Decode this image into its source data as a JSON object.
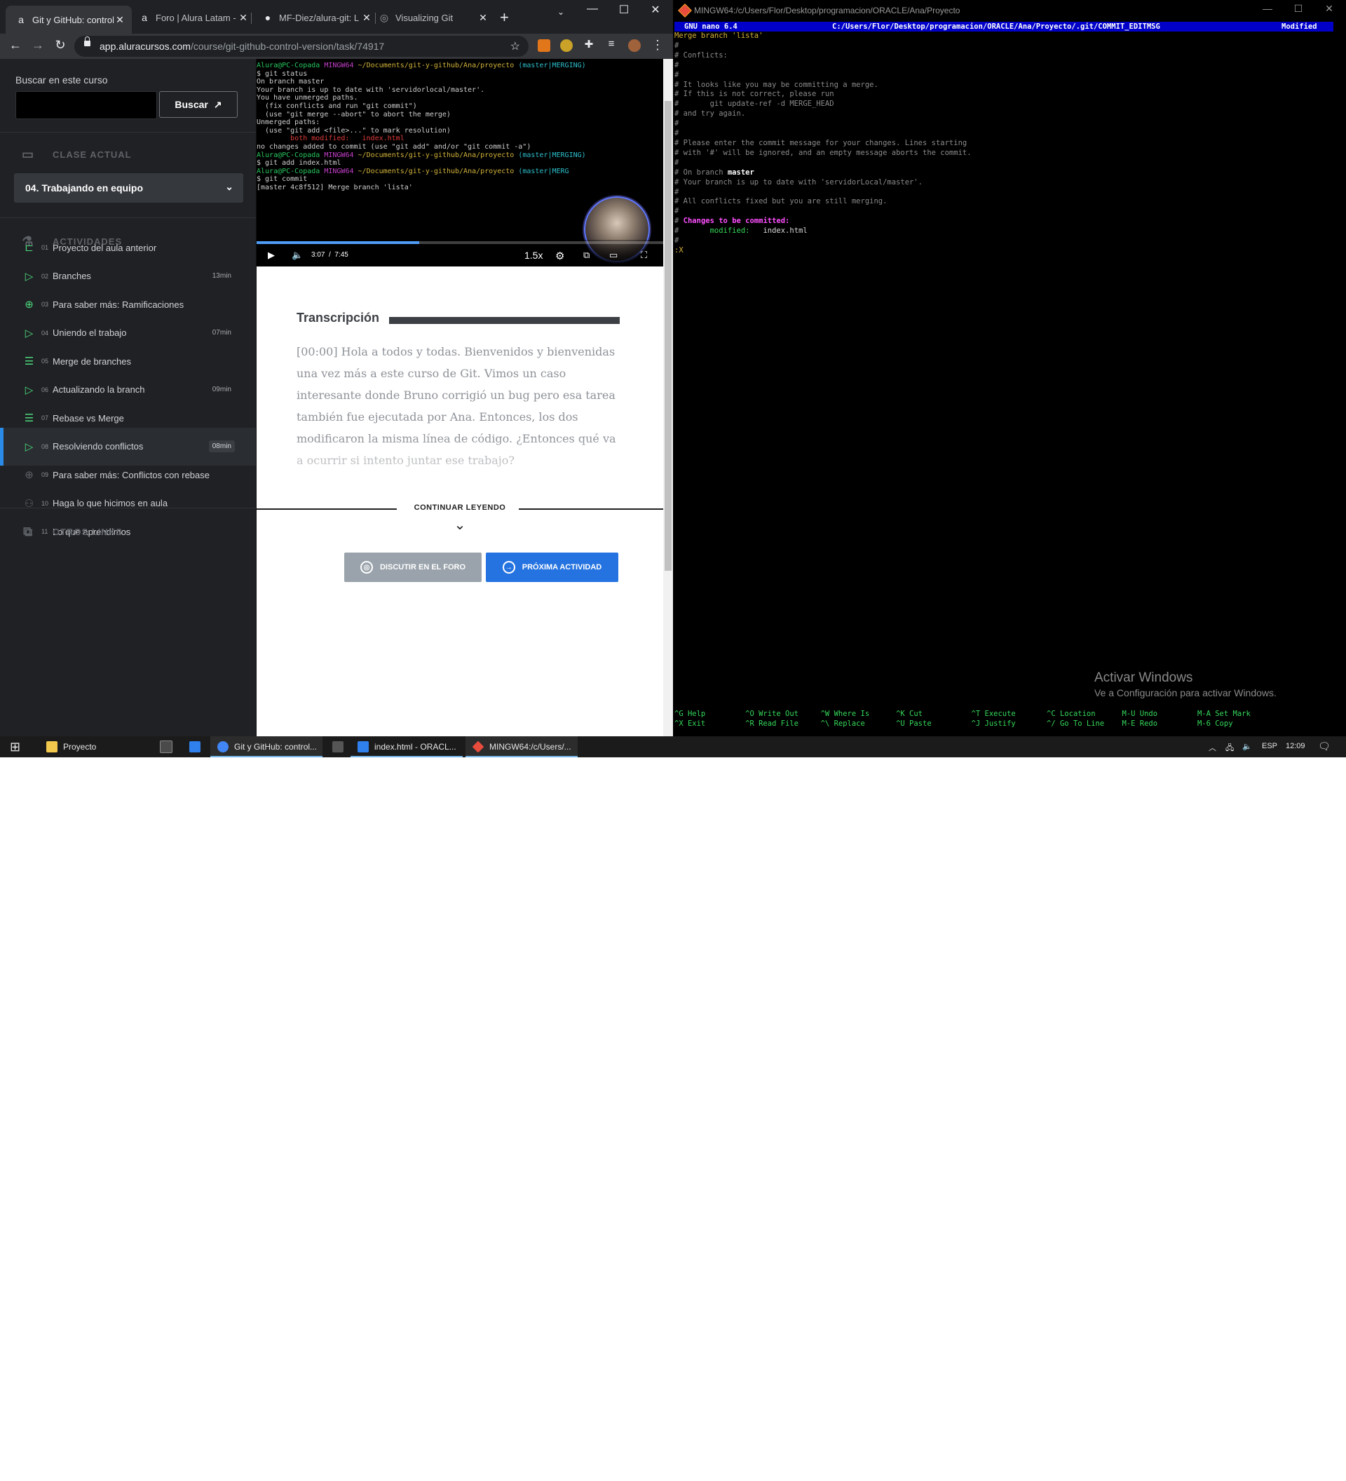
{
  "browser": {
    "tabs": [
      {
        "title": "Git y GitHub: control",
        "favicon": "alura-a-icon"
      },
      {
        "title": "Foro | Alura Latam -",
        "favicon": "alura-a-icon"
      },
      {
        "title": "MF-Diez/alura-git: L",
        "favicon": "github-icon"
      },
      {
        "title": "Visualizing Git",
        "favicon": "globe-icon"
      }
    ],
    "url_domain": "app.aluracursos.com",
    "url_path": "/course/git-github-control-version/task/74917"
  },
  "sidebar": {
    "search_label": "Buscar en este curso",
    "search_value": "",
    "search_button": "Buscar",
    "current_class_heading": "CLASE ACTUAL",
    "current_class": "04. Trabajando en equipo",
    "activities_heading": "ACTIVIDADES",
    "activities": [
      {
        "num": "01",
        "label": "Proyecto del aula anterior",
        "duration": "",
        "icon": "book-icon"
      },
      {
        "num": "02",
        "label": "Branches",
        "duration": "13min",
        "icon": "video-icon"
      },
      {
        "num": "03",
        "label": "Para saber más: Ramificaciones",
        "duration": "",
        "icon": "plus-circle-icon"
      },
      {
        "num": "04",
        "label": "Uniendo el trabajo",
        "duration": "07min",
        "icon": "video-icon"
      },
      {
        "num": "05",
        "label": "Merge de branches",
        "duration": "",
        "icon": "list-icon"
      },
      {
        "num": "06",
        "label": "Actualizando la branch",
        "duration": "09min",
        "icon": "video-icon"
      },
      {
        "num": "07",
        "label": "Rebase vs Merge",
        "duration": "",
        "icon": "list-icon"
      },
      {
        "num": "08",
        "label": "Resolviendo conflictos",
        "duration": "08min",
        "icon": "video-icon"
      },
      {
        "num": "09",
        "label": "Para saber más: Conflictos con rebase",
        "duration": "",
        "icon": "plus-circle-icon"
      },
      {
        "num": "10",
        "label": "Haga lo que hicimos en aula",
        "duration": "",
        "icon": "hands-icon"
      },
      {
        "num": "11",
        "label": "Lo que aprendimos",
        "duration": "",
        "icon": "book-icon"
      }
    ],
    "other_links_heading": "OTROS LINKS"
  },
  "video": {
    "terminal_lines": [
      {
        "prompt_user": "Alura@PC-Copada",
        "prompt_env": "MINGW64",
        "prompt_path": "~/Documents/git-y-github/Ana/proyecto",
        "prompt_branch": "(master|MERGING)"
      },
      {
        "text": "$ git status"
      },
      {
        "text": "On branch master"
      },
      {
        "text": "Your branch is up to date with 'servidorlocal/master'."
      },
      {
        "text": ""
      },
      {
        "text": "You have unmerged paths."
      },
      {
        "text": "  (fix conflicts and run \"git commit\")"
      },
      {
        "text": "  (use \"git merge --abort\" to abort the merge)"
      },
      {
        "text": ""
      },
      {
        "text": "Unmerged paths:"
      },
      {
        "text": "  (use \"git add <file>...\" to mark resolution)"
      },
      {
        "red": "        both modified:   index.html"
      },
      {
        "text": ""
      },
      {
        "text": "no changes added to commit (use \"git add\" and/or \"git commit -a\")"
      },
      {
        "text": ""
      },
      {
        "prompt_user": "Alura@PC-Copada",
        "prompt_env": "MINGW64",
        "prompt_path": "~/Documents/git-y-github/Ana/proyecto",
        "prompt_branch": "(master|MERGING)"
      },
      {
        "text": "$ git add index.html"
      },
      {
        "text": ""
      },
      {
        "prompt_user": "Alura@PC-Copada",
        "prompt_env": "MINGW64",
        "prompt_path": "~/Documents/git-y-github/Ana/proyecto",
        "prompt_branch": "(master|MERG"
      },
      {
        "text": "$ git commit"
      },
      {
        "text": "[master 4c8f512] Merge branch 'lista'"
      }
    ],
    "current_time": "3:07",
    "duration": "7:45",
    "progress": 0.4,
    "speed": "1.5x"
  },
  "transcript": {
    "title": "Transcripción",
    "text": "[00:00] Hola a todos y todas. Bienvenidos y bienvenidas una vez más a este curso de Git. Vimos un caso interesante donde Bruno corrigió un bug pero esa tarea también fue ejecutada por Ana. Entonces, los dos modificaron la misma línea de código. ¿Entonces qué va a ocurrir si intento juntar ese trabajo?",
    "continue_label": "CONTINUAR LEYENDO",
    "forum_button": "DISCUTIR EN EL FORO",
    "next_button": "PRÓXIMA ACTIVIDAD"
  },
  "terminal": {
    "title": "MINGW64:/c/Users/Flor/Desktop/programacion/ORACLE/Ana/Proyecto",
    "nano_version": "GNU nano 6.4",
    "nano_file": "C:/Users/Flor/Desktop/programacion/ORACLE/Ana/Proyecto/.git/COMMIT_EDITMSG",
    "nano_status": "Modified",
    "first_line": "Merge branch 'lista'",
    "comment_lines": [
      "#",
      "# Conflicts:",
      "#",
      "#",
      "# It looks like you may be committing a merge.",
      "# If this is not correct, please run",
      "#       git update-ref -d MERGE_HEAD",
      "# and try again.",
      "#",
      "#",
      "# Please enter the commit message for your changes. Lines starting",
      "# with '#' will be ignored, and an empty message aborts the commit.",
      "#"
    ],
    "on_branch_prefix": "# On branch ",
    "on_branch_name": "master",
    "after_branch_lines": [
      "# Your branch is up to date with 'servidorLocal/master'.",
      "#",
      "# All conflicts fixed but you are still merging.",
      "#"
    ],
    "changes_heading": "Changes to be committed:",
    "modified_label": "modified:",
    "modified_file": "index.html",
    "tail_lines": [
      "#"
    ],
    "cursor_line": ":X",
    "shortcuts_row1": "^G Help         ^O Write Out     ^W Where Is      ^K Cut           ^T Execute       ^C Location      M-U Undo         M-A Set Mark",
    "shortcuts_row2": "^X Exit         ^R Read File     ^\\ Replace       ^U Paste         ^J Justify       ^/ Go To Line    M-E Redo         M-6 Copy",
    "watermark_title": "Activar Windows",
    "watermark_sub": "Ve a Configuración para activar Windows."
  },
  "taskbar": {
    "items": [
      {
        "label": "Proyecto",
        "color": "#f2c94c"
      },
      {
        "label": "Git y GitHub: control...",
        "color": "#4285f4"
      },
      {
        "label": "index.html - ORACL...",
        "color": "#2f80ed"
      },
      {
        "label": "MINGW64:/c/Users/...",
        "color": "#e74c3c"
      }
    ],
    "language": "ESP",
    "clock": "12:09"
  }
}
